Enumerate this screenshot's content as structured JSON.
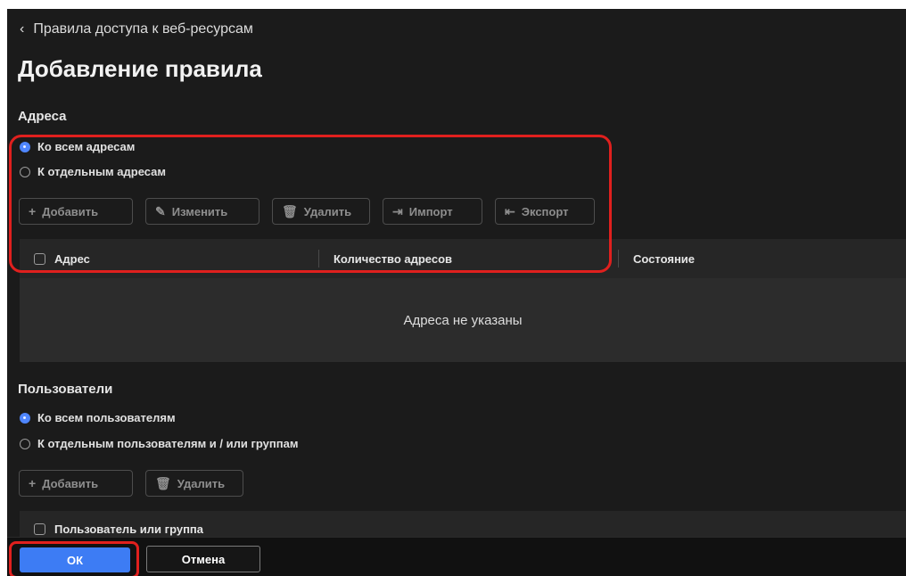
{
  "nav": {
    "back_icon": "chevron-left-icon",
    "back_label": "Правила доступа к веб-ресурсам"
  },
  "page": {
    "title": "Добавление правила"
  },
  "addresses": {
    "title": "Адреса",
    "options": [
      {
        "label": "Ко всем адресам",
        "checked": true
      },
      {
        "label": "К отдельным адресам",
        "checked": false
      }
    ],
    "buttons": [
      {
        "icon": "plus-icon",
        "label": "Добавить"
      },
      {
        "icon": "pencil-icon",
        "label": "Изменить"
      },
      {
        "icon": "trash-icon",
        "label": "Удалить"
      },
      {
        "icon": "import-icon",
        "label": "Импорт"
      },
      {
        "icon": "export-icon",
        "label": "Экспорт"
      }
    ],
    "columns": [
      "Адрес",
      "Количество адресов",
      "Состояние"
    ],
    "empty_text": "Адреса не указаны"
  },
  "users": {
    "title": "Пользователи",
    "options": [
      {
        "label": "Ко всем пользователям",
        "checked": true
      },
      {
        "label": "К отдельным пользователям и / или группам",
        "checked": false
      }
    ],
    "buttons": [
      {
        "icon": "plus-icon",
        "label": "Добавить"
      },
      {
        "icon": "trash-icon",
        "label": "Удалить"
      }
    ],
    "columns": [
      "Пользователь или группа"
    ]
  },
  "footer": {
    "ok_label": "ОК",
    "cancel_label": "Отмена"
  },
  "colors": {
    "background": "#1b1b1b",
    "accent": "#3d7cf4",
    "highlight": "#e0201e"
  }
}
